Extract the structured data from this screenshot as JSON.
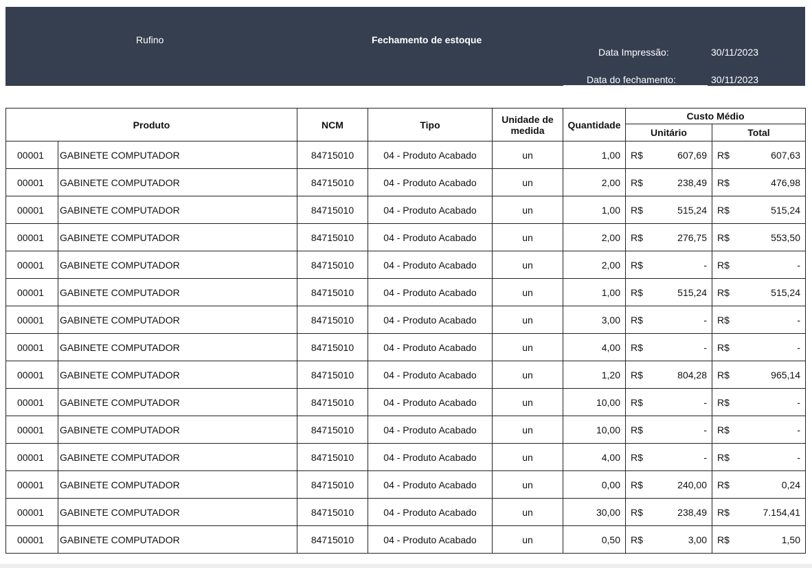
{
  "header": {
    "company": "Rufino",
    "title": "Fechamento de estoque",
    "print_date_label": "Data Impressão:",
    "print_date": "30/11/2023",
    "closing_date_label": "Data do fechamento:",
    "closing_date": "30/11/2023"
  },
  "columns": {
    "produto": "Produto",
    "ncm": "NCM",
    "tipo": "Tipo",
    "unidade": "Unidade de medida",
    "quantidade": "Quantidade",
    "custo_medio": "Custo Médio",
    "unitario": "Unitário",
    "total": "Total"
  },
  "currency": "R$",
  "rows": [
    {
      "code": "00001",
      "name": "GABINETE COMPUTADOR",
      "ncm": "84715010",
      "tipo": "04 - Produto Acabado",
      "un": "un",
      "qty": "1,00",
      "unit": "607,69",
      "total": "607,63"
    },
    {
      "code": "00001",
      "name": "GABINETE COMPUTADOR",
      "ncm": "84715010",
      "tipo": "04 - Produto Acabado",
      "un": "un",
      "qty": "2,00",
      "unit": "238,49",
      "total": "476,98"
    },
    {
      "code": "00001",
      "name": "GABINETE COMPUTADOR",
      "ncm": "84715010",
      "tipo": "04 - Produto Acabado",
      "un": "un",
      "qty": "1,00",
      "unit": "515,24",
      "total": "515,24"
    },
    {
      "code": "00001",
      "name": "GABINETE COMPUTADOR",
      "ncm": "84715010",
      "tipo": "04 - Produto Acabado",
      "un": "un",
      "qty": "2,00",
      "unit": "276,75",
      "total": "553,50"
    },
    {
      "code": "00001",
      "name": "GABINETE COMPUTADOR",
      "ncm": "84715010",
      "tipo": "04 - Produto Acabado",
      "un": "un",
      "qty": "2,00",
      "unit": "-",
      "total": "-"
    },
    {
      "code": "00001",
      "name": "GABINETE COMPUTADOR",
      "ncm": "84715010",
      "tipo": "04 - Produto Acabado",
      "un": "un",
      "qty": "1,00",
      "unit": "515,24",
      "total": "515,24"
    },
    {
      "code": "00001",
      "name": "GABINETE COMPUTADOR",
      "ncm": "84715010",
      "tipo": "04 - Produto Acabado",
      "un": "un",
      "qty": "3,00",
      "unit": "-",
      "total": "-"
    },
    {
      "code": "00001",
      "name": "GABINETE COMPUTADOR",
      "ncm": "84715010",
      "tipo": "04 - Produto Acabado",
      "un": "un",
      "qty": "4,00",
      "unit": "-",
      "total": "-"
    },
    {
      "code": "00001",
      "name": "GABINETE COMPUTADOR",
      "ncm": "84715010",
      "tipo": "04 - Produto Acabado",
      "un": "un",
      "qty": "1,20",
      "unit": "804,28",
      "total": "965,14"
    },
    {
      "code": "00001",
      "name": "GABINETE COMPUTADOR",
      "ncm": "84715010",
      "tipo": "04 - Produto Acabado",
      "un": "un",
      "qty": "10,00",
      "unit": "-",
      "total": "-"
    },
    {
      "code": "00001",
      "name": "GABINETE COMPUTADOR",
      "ncm": "84715010",
      "tipo": "04 - Produto Acabado",
      "un": "un",
      "qty": "10,00",
      "unit": "-",
      "total": "-"
    },
    {
      "code": "00001",
      "name": "GABINETE COMPUTADOR",
      "ncm": "84715010",
      "tipo": "04 - Produto Acabado",
      "un": "un",
      "qty": "4,00",
      "unit": "-",
      "total": "-"
    },
    {
      "code": "00001",
      "name": "GABINETE COMPUTADOR",
      "ncm": "84715010",
      "tipo": "04 - Produto Acabado",
      "un": "un",
      "qty": "0,00",
      "unit": "240,00",
      "total": "0,24"
    },
    {
      "code": "00001",
      "name": "GABINETE COMPUTADOR",
      "ncm": "84715010",
      "tipo": "04 - Produto Acabado",
      "un": "un",
      "qty": "30,00",
      "unit": "238,49",
      "total": "7.154,41"
    },
    {
      "code": "00001",
      "name": "GABINETE COMPUTADOR",
      "ncm": "84715010",
      "tipo": "04 - Produto Acabado",
      "un": "un",
      "qty": "0,50",
      "unit": "3,00",
      "total": "1,50"
    }
  ]
}
